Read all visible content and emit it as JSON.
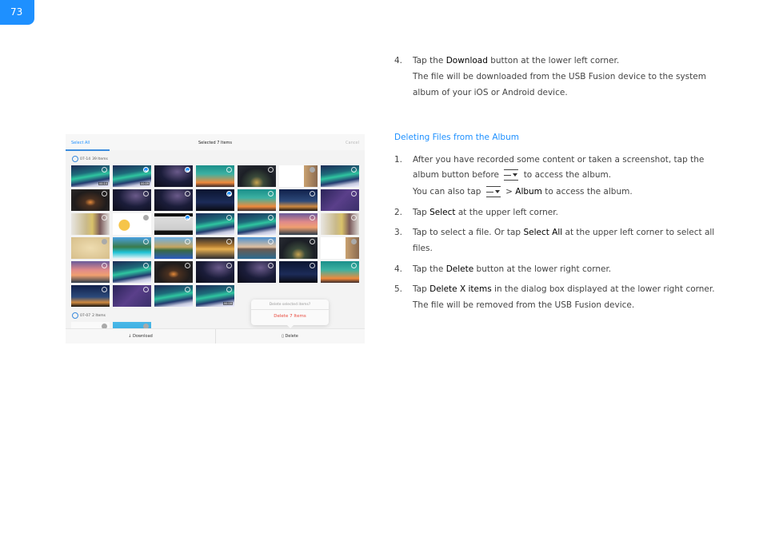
{
  "page_number": "73",
  "step4_download": {
    "num": "4.",
    "pre": "Tap the ",
    "bold": "Download",
    "post": " button at the lower left corner.",
    "line2": "The file will be downloaded from the USB Fusion device to the system",
    "line3": "album of your iOS or Android device."
  },
  "section_heading": "Deleting Files from the Album",
  "steps": {
    "s1": {
      "num": "1.",
      "line1": "After you have recorded some content or taken a screenshot, tap the",
      "line2a": "album button before",
      "line2b": "to access the album.",
      "line3a": "You can also tap",
      "line3b": " > ",
      "line3bold": "Album",
      "line3c": " to access the album.",
      "icon": "menu-dropdown-icon"
    },
    "s2": {
      "num": "2.",
      "pre": "Tap ",
      "bold": "Select",
      "post": " at the upper left corner."
    },
    "s3": {
      "num": "3.",
      "pre": "Tap to select a file. Or tap ",
      "bold": "Select All",
      "post": " at the upper left corner to select all",
      "line2": "files."
    },
    "s4": {
      "num": "4.",
      "pre": "Tap the ",
      "bold": "Delete",
      "post": " button at the lower right corner."
    },
    "s5": {
      "num": "5.",
      "pre": "Tap ",
      "bold": "Delete X items",
      "post": " in the dialog box displayed at the lower right corner.",
      "line2": "The file will be removed from the USB Fusion device."
    }
  },
  "screenshot": {
    "select_all": "Select All",
    "title": "Selected 7 Items",
    "cancel": "Cancel",
    "sections": [
      {
        "date": "07-14",
        "count": "39 Items"
      },
      {
        "date": "07-07",
        "count": "2 Items"
      }
    ],
    "thumbs1": [
      {
        "k": "aurora",
        "s": "",
        "d": "00:14"
      },
      {
        "k": "aurora",
        "s": "sel",
        "d": "00:09"
      },
      {
        "k": "milky",
        "s": "sel"
      },
      {
        "k": "teal",
        "s": ""
      },
      {
        "k": "camp",
        "s": ""
      },
      {
        "k": "doc",
        "s": "gray"
      },
      {
        "k": "aurora",
        "s": ""
      },
      {
        "k": "fire",
        "s": ""
      },
      {
        "k": "milky",
        "s": ""
      },
      {
        "k": "milky",
        "s": ""
      },
      {
        "k": "night",
        "s": "sel"
      },
      {
        "k": "teal",
        "s": ""
      },
      {
        "k": "tree",
        "s": ""
      },
      {
        "k": "purple",
        "s": ""
      },
      {
        "k": "people",
        "s": ""
      },
      {
        "k": "bulb",
        "s": "gray"
      },
      {
        "k": "bulbscr",
        "s": "sel"
      },
      {
        "k": "aurora",
        "s": ""
      },
      {
        "k": "aurora",
        "s": ""
      },
      {
        "k": "sunset",
        "s": ""
      },
      {
        "k": "people",
        "s": ""
      },
      {
        "k": "paper",
        "s": "gray"
      },
      {
        "k": "tropic",
        "s": ""
      },
      {
        "k": "mount",
        "s": ""
      },
      {
        "k": "lakeset",
        "s": ""
      },
      {
        "k": "lake",
        "s": ""
      },
      {
        "k": "camp",
        "s": ""
      },
      {
        "k": "doc",
        "s": "gray"
      },
      {
        "k": "sunset",
        "s": ""
      },
      {
        "k": "aurora",
        "s": ""
      },
      {
        "k": "fire",
        "s": ""
      },
      {
        "k": "milky",
        "s": ""
      },
      {
        "k": "milky",
        "s": ""
      },
      {
        "k": "night",
        "s": ""
      },
      {
        "k": "teal",
        "s": ""
      },
      {
        "k": "tree",
        "s": ""
      },
      {
        "k": "purple",
        "s": ""
      },
      {
        "k": "aurora",
        "s": ""
      },
      {
        "k": "aurora",
        "s": "",
        "d": "00:16"
      }
    ],
    "thumbs2": [
      {
        "k": "white",
        "s": "gray"
      },
      {
        "k": "blue",
        "s": "gray"
      }
    ],
    "dialog_question": "Delete selected items?",
    "dialog_action": "Delete 7 Items",
    "download": "Download",
    "delete": "Delete"
  },
  "colors": {
    "accent": "#1e90ff",
    "danger": "#e8483c"
  }
}
